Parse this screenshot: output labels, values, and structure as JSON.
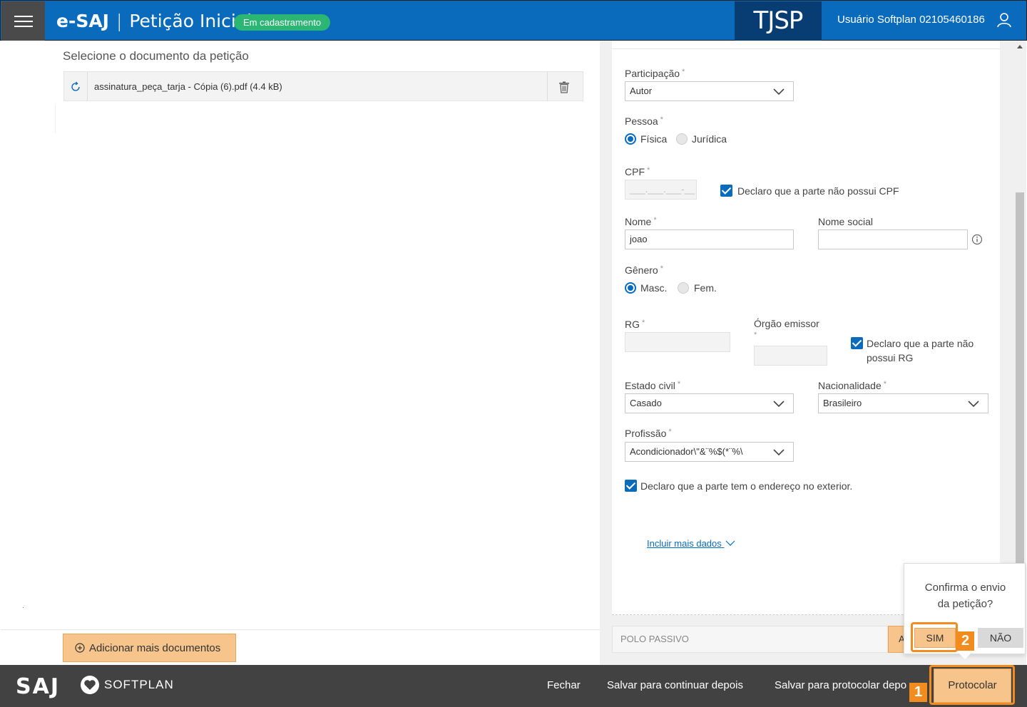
{
  "header": {
    "app_name": "e-SAJ",
    "separator": "|",
    "page_title": "Petição Inicial",
    "status_badge": "Em cadastramento",
    "court_logo": "TJSP",
    "user_name": "Usuário Softplan 02105460186"
  },
  "left": {
    "select_label": "Selecione o documento da petição",
    "document_name": "assinatura_peça_tarja - Cópia (6).pdf (4.4 kB)",
    "add_docs_label": "Adicionar mais documentos"
  },
  "form": {
    "participacao_label": "Participação",
    "participacao_value": "Autor",
    "pessoa_label": "Pessoa",
    "pessoa_options": [
      "Física",
      "Jurídica"
    ],
    "pessoa_selected": "Física",
    "cpf_label": "CPF",
    "cpf_placeholder": "___.___.___-__",
    "cpf_declaro": "Declaro que a parte não possui CPF",
    "nome_label": "Nome",
    "nome_value": "joao",
    "nome_social_label": "Nome social",
    "genero_label": "Gênero",
    "genero_options": [
      "Masc.",
      "Fem."
    ],
    "genero_selected": "Masc.",
    "rg_label": "RG",
    "orgao_label": "Órgão emissor",
    "rg_declaro_line1": "Declaro que a parte não",
    "rg_declaro_line2": "possui RG",
    "estado_civil_label": "Estado civil",
    "estado_civil_value": "Casado",
    "nacionalidade_label": "Nacionalidade",
    "nacionalidade_value": "Brasileiro",
    "profissao_label": "Profissão",
    "profissao_value": "Acondicionador\\\"&¨%$(*¨%\\",
    "exterior_declaro": "Declaro que a parte tem o endereço no exterior.",
    "incluir_mais": "Incluir mais dados",
    "required_mark": "*"
  },
  "polo": {
    "label": "POLO PASSIVO",
    "orange_partial": "A"
  },
  "confirm": {
    "question_line1": "Confirma o envio",
    "question_line2": "da petição?",
    "yes": "SIM",
    "no": "NÃO",
    "step_2": "2"
  },
  "footer": {
    "saj_logo": "SAJ",
    "softplan": "SOFTPLAN",
    "fechar": "Fechar",
    "salvar_continuar": "Salvar para continuar depois",
    "salvar_protocolar": "Salvar para protocolar depois",
    "protocolar": "Protocolar",
    "step_1": "1"
  },
  "colors": {
    "header_blue": "#0a6bbd",
    "court_navy": "#083d73",
    "badge_green": "#2bb673",
    "accent_orange": "#f7c48c",
    "callout_orange": "#f28c1f",
    "footer_gray": "#424242"
  },
  "icons": [
    "menu-icon",
    "user-icon",
    "refresh-icon",
    "trash-icon",
    "plus-circle-icon",
    "chevron-down-icon",
    "info-icon",
    "softplan-heart-icon"
  ]
}
